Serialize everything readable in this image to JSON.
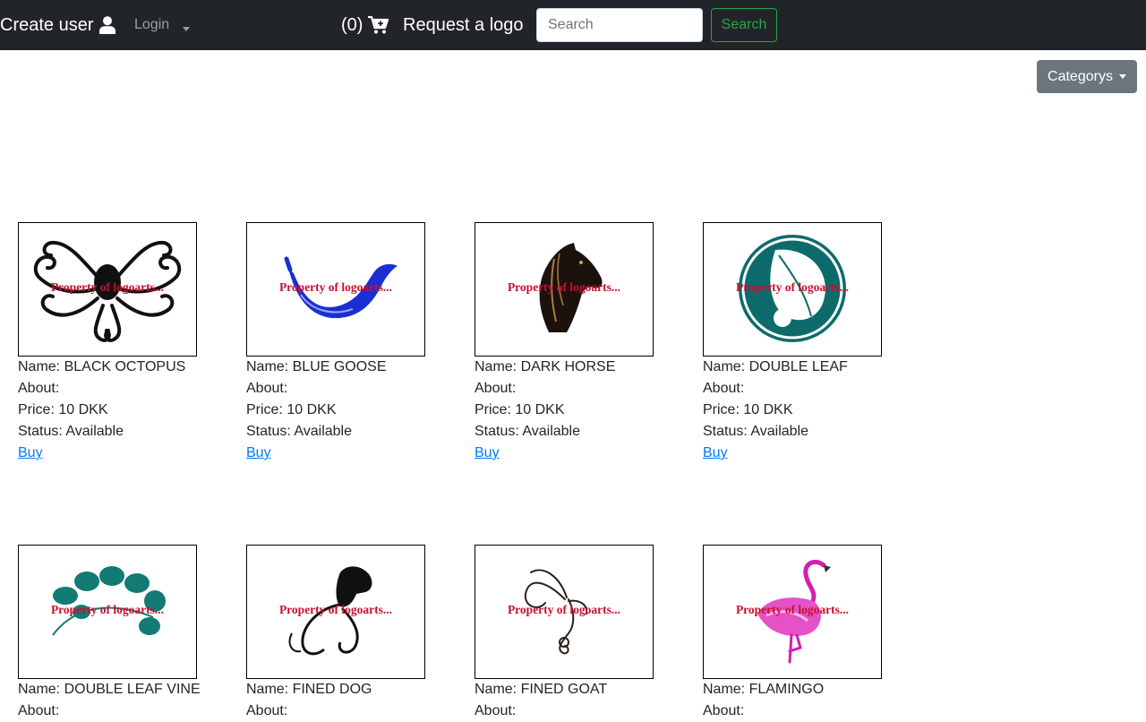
{
  "nav": {
    "create_user": "Create user",
    "login": "Login",
    "cart_count": "(0)",
    "request_logo": "Request a logo",
    "search_placeholder": "Search",
    "search_button": "Search",
    "icons": [
      "user-icon",
      "chevron-down-icon",
      "cart-plus-icon"
    ]
  },
  "categories_button": "Categorys",
  "watermark": "Property of logoarts...",
  "colors": {
    "navbar_bg": "#212529",
    "search_green": "#28a745",
    "categories_gray": "#6c757d",
    "link_blue": "#007bff",
    "watermark_red": "#c8102e"
  },
  "products": [
    {
      "name": "Name: BLACK OCTOPUS",
      "about": "About:",
      "price": "Price: 10 DKK",
      "status": "Status: Available",
      "buy": "Buy"
    },
    {
      "name": "Name: BLUE GOOSE",
      "about": "About:",
      "price": "Price: 10 DKK",
      "status": "Status: Available",
      "buy": "Buy"
    },
    {
      "name": "Name: DARK HORSE",
      "about": "About:",
      "price": "Price: 10 DKK",
      "status": "Status: Available",
      "buy": "Buy"
    },
    {
      "name": "Name: DOUBLE LEAF",
      "about": "About:",
      "price": "Price: 10 DKK",
      "status": "Status: Available",
      "buy": "Buy"
    },
    {
      "name": "Name: DOUBLE LEAF VINE",
      "about": "About:"
    },
    {
      "name": "Name: FINED DOG",
      "about": "About:"
    },
    {
      "name": "Name: FINED GOAT",
      "about": "About:"
    },
    {
      "name": "Name: FLAMINGO",
      "about": "About:"
    }
  ]
}
